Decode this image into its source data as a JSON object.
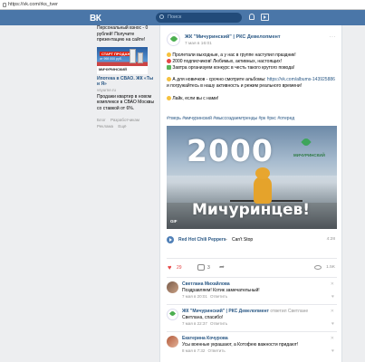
{
  "browser": {
    "url": "https://vk.com/rks_tver"
  },
  "header": {
    "logo": "ВК",
    "search_placeholder": "Поиск"
  },
  "sidebar": {
    "ad_text": "Персональный взнос - 0 рублей! Получите презентацию на сайте!",
    "ad_image": {
      "tag": "СТАРТ ПРОДАЖ",
      "price": "от 998 000 руб.",
      "band": "МИЧУРИНСКИЙ"
    },
    "ad_title": "Ипотека в СВАО. ЖК «Ты и Я»",
    "ad_host": "vsyurne.ru",
    "ad_desc": "Продажи квартир в новом комплексе в СВАО Москвы со ставкой от 6%.",
    "footer_links": [
      "Блог",
      "Разработчикам",
      "Реклама",
      "Ещё"
    ]
  },
  "post": {
    "author": "ЖК \"Мичуринский\" | РКС Девелопмент",
    "date": "7 мая в 16:01",
    "more": "···",
    "lines": [
      "Пролетали выходные, а у нас в группе наступил праздник!",
      "2000 подписчиков! Любимых, активных, настоящих!",
      "Завтра организуем конкурс в честь такого крутого повода!"
    ],
    "para2_start": "А для новичков - срочно смотрите альбомы: ",
    "para2_link": "https://vk.com/albums-143925886",
    "para2_end": " и погружайтесь в нашу активность и режим реального времени!",
    "para3": "Лайк, если вы с нами!",
    "hashtags": "#тверь #мичуринский #мыссоздаемтренды #рк #ркс #отеред",
    "video": {
      "big_text": "2000",
      "sub_text": "Мичуринцев!",
      "logo_text": "МИЧУРИНСКИЙ",
      "badge": "GIF"
    },
    "audio": {
      "artist": "Red Hot Chili Peppers",
      "dash": "–",
      "title": "Can't Stop",
      "duration": "4:28"
    },
    "actions": {
      "likes": "29",
      "comments": "3",
      "views": "1.5K"
    }
  },
  "comments": [
    {
      "name": "Светлана Михайлова",
      "text": "Поздравляем! Котик замечательный!",
      "date": "7 мая в 20:01",
      "reply": "Ответить"
    },
    {
      "name": "ЖК \"Мичуринский\" | РКС Девелопмент",
      "name_suffix": "ответил Светлане",
      "text": "Светлана, спасибо!",
      "date": "7 мая в 22:37",
      "reply": "Ответить"
    },
    {
      "name": "Екатерина Кочурова",
      "text": "Усы военные украшают, а Котофею важности придают!",
      "date": "8 мая в 7:32",
      "reply": "Ответить"
    }
  ],
  "colors": {
    "brand": "#4a76a8",
    "link": "#2a5885",
    "like": "#e64646"
  }
}
